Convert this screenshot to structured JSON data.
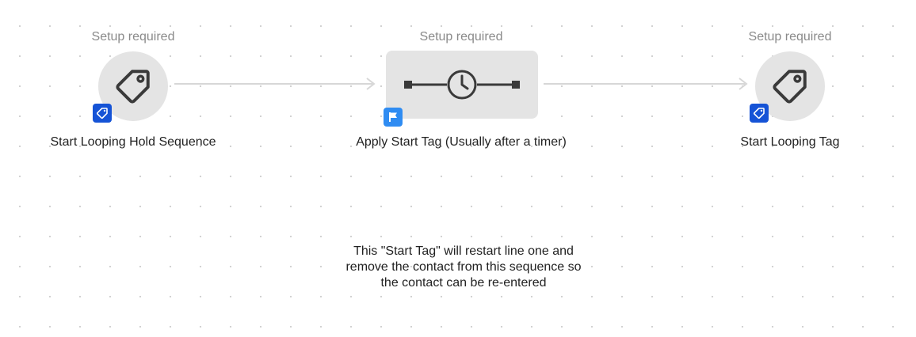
{
  "nodes": [
    {
      "status": "Setup required",
      "label": "Start Looping Hold Sequence",
      "icon": "tag-icon",
      "badge_icon": "tag-badge-icon"
    },
    {
      "status": "Setup required",
      "label": "Apply Start Tag (Usually after a timer)",
      "icon": "timer-delay-icon",
      "badge_icon": "flag-badge-icon"
    },
    {
      "status": "Setup required",
      "label": "Start Looping Tag",
      "icon": "tag-icon",
      "badge_icon": "tag-badge-icon"
    }
  ],
  "note": {
    "lines": [
      "This \"Start Tag\" will restart line one and",
      "remove the contact from this sequence so",
      "the contact can be re-entered"
    ]
  },
  "colors": {
    "canvas_background": "#ffffff",
    "canvas_dot": "#cfcfcf",
    "node_fill": "#e4e4e4",
    "connector": "#d7d7d7",
    "tag_badge": "#1553d6",
    "flag_badge": "#2f8cf2",
    "status_text": "#8a8a8a"
  }
}
